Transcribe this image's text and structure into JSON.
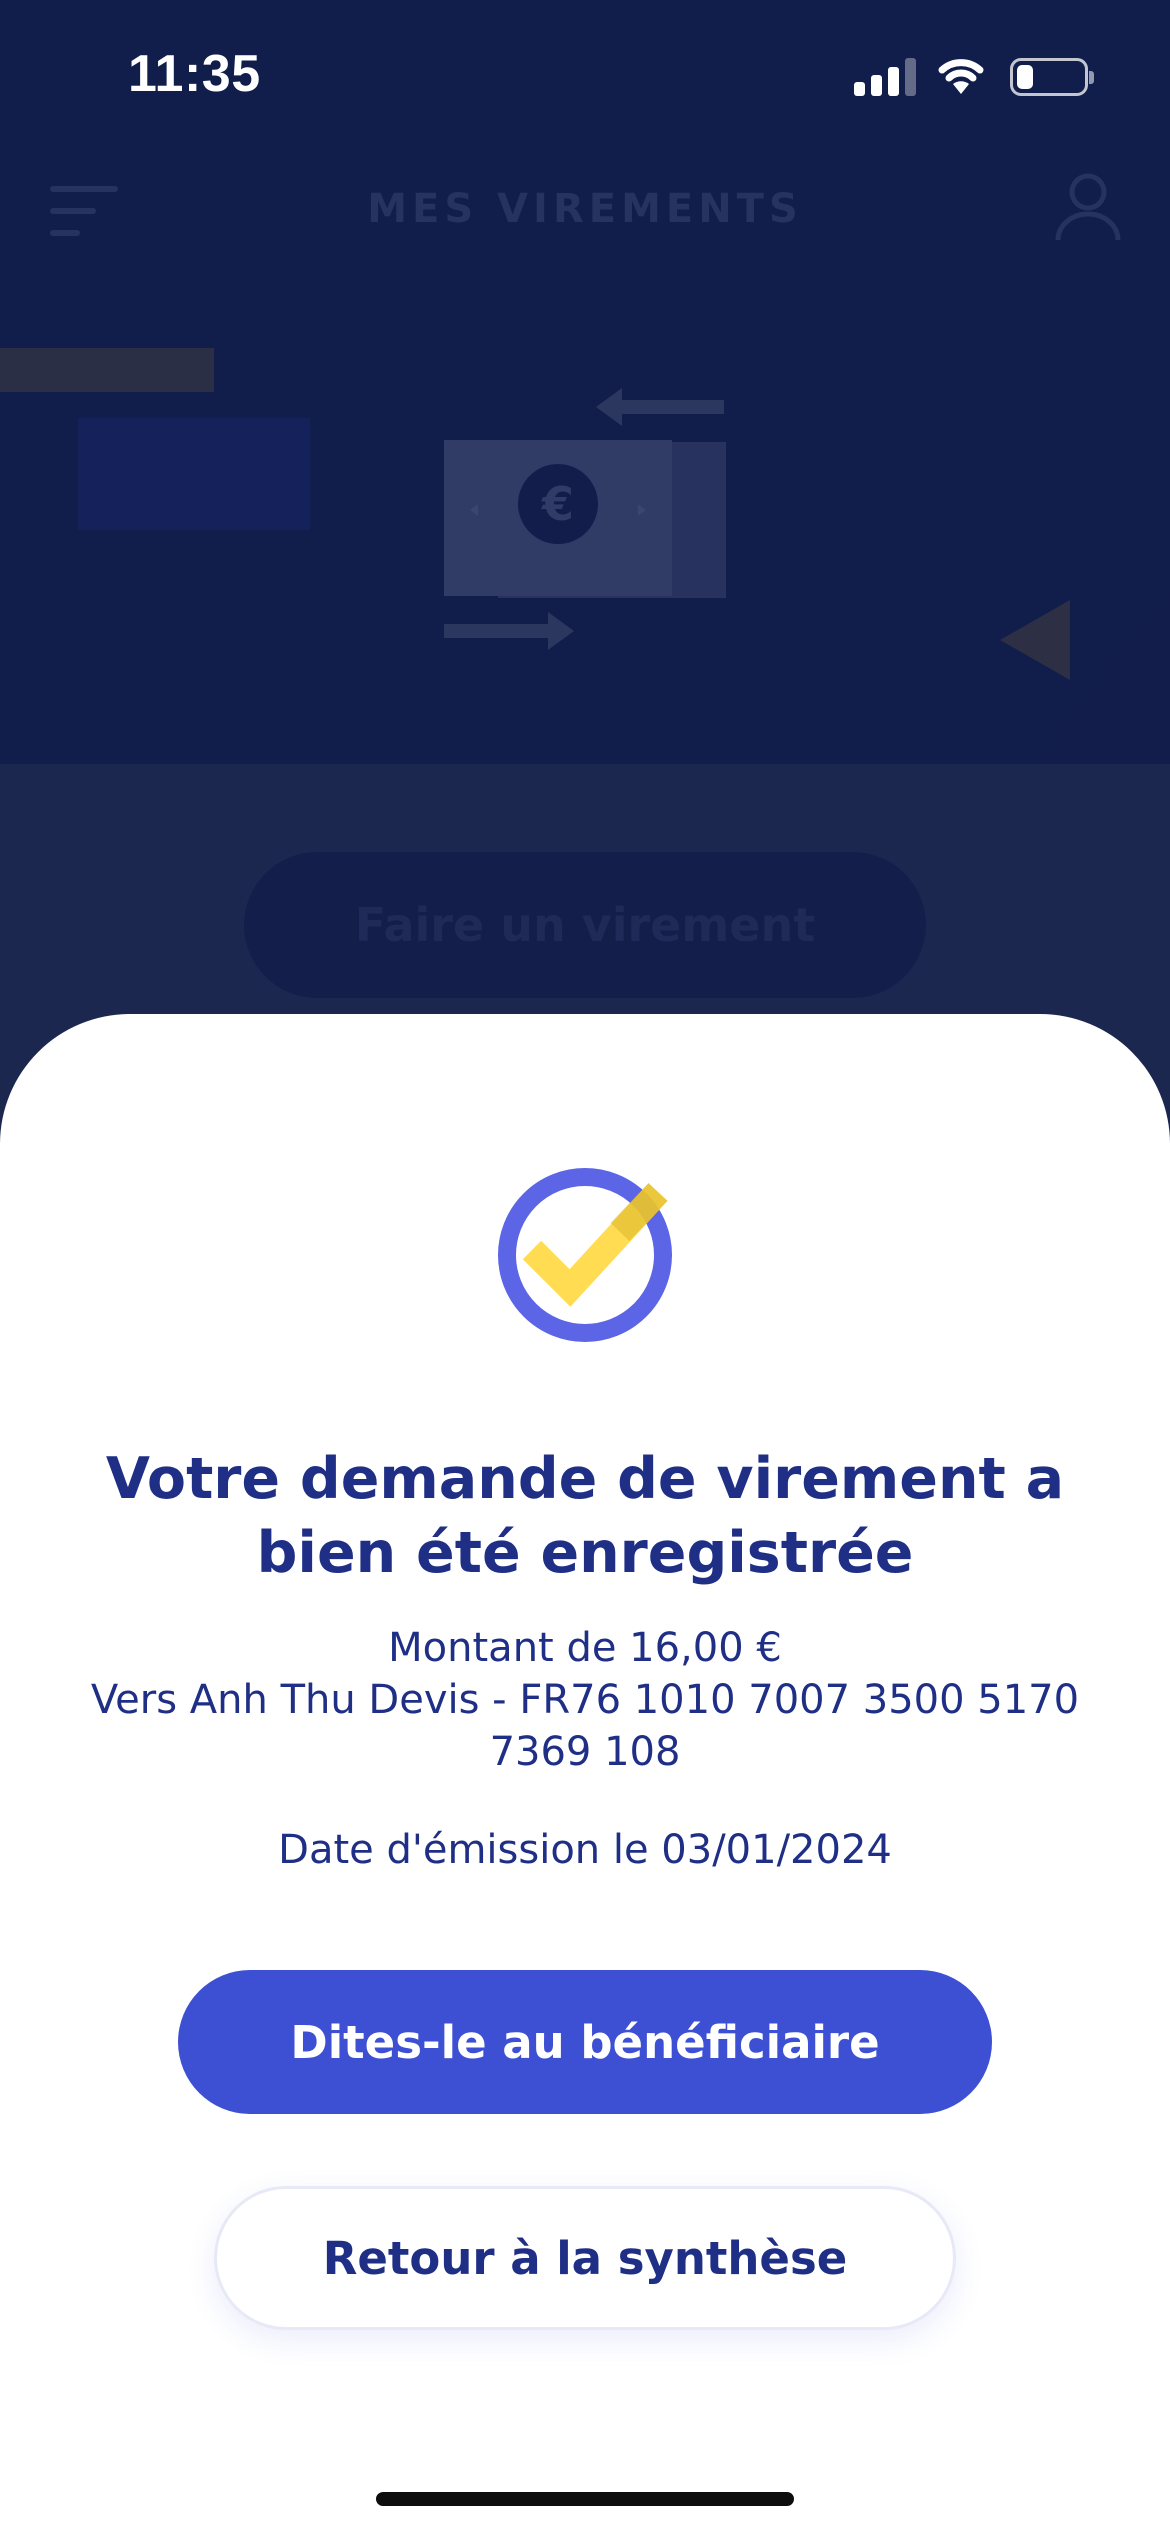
{
  "status_bar": {
    "time": "11:35",
    "signal_icon": "cellular-signal-icon",
    "wifi_icon": "wifi-icon",
    "battery_icon": "battery-icon",
    "battery_level": 0.25
  },
  "nav": {
    "menu_icon": "menu-icon",
    "title": "MES VIREMENTS",
    "user_icon": "user-profile-icon"
  },
  "background": {
    "illustration_icon": "euro-transfer-illustration",
    "action_label": "Faire un virement"
  },
  "sheet": {
    "icon": "success-check-icon",
    "title_line1": "Votre demande de virement a",
    "title_line2": "bien été enregistrée",
    "amount_line": "Montant de 16,00 €",
    "recipient_line1": "Vers Anh Thu Devis - FR76 1010 7007 3500 5170",
    "recipient_line2": "7369 108",
    "date_line": "Date d'émission le 03/01/2024",
    "primary_button": "Dites-le au bénéficiaire",
    "secondary_button": "Retour à la synthèse"
  },
  "colors": {
    "brand_dark": "#111d4a",
    "accent_blue": "#3d50d3",
    "title_blue": "#1f2f86",
    "ring_purple": "#5b65e6",
    "check_yellow": "#ffd633"
  }
}
